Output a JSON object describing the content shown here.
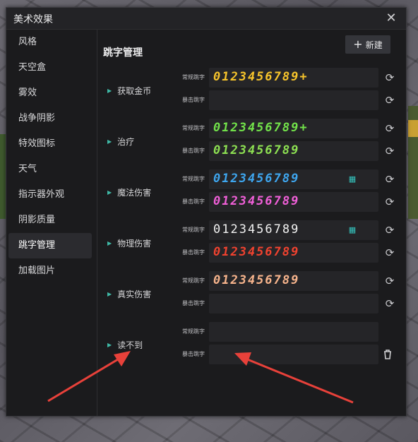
{
  "window": {
    "title": "美术效果",
    "close_glyph": "✕"
  },
  "sidebar": {
    "items": [
      {
        "label": "风格"
      },
      {
        "label": "天空盒"
      },
      {
        "label": "雾效"
      },
      {
        "label": "战争阴影"
      },
      {
        "label": "特效图标"
      },
      {
        "label": "天气"
      },
      {
        "label": "指示器外观"
      },
      {
        "label": "阴影质量"
      },
      {
        "label": "跳字管理"
      },
      {
        "label": "加载图片"
      }
    ],
    "active": "跳字管理"
  },
  "main": {
    "title": "跳字管理",
    "new_button": {
      "icon": "+",
      "label": "新建"
    },
    "row_labels": {
      "normal": "常规跳字",
      "crit": "暴击跳字"
    },
    "groups": [
      {
        "name": "获取金币",
        "normal": {
          "text": "0123456789+",
          "color": "#f7c42b"
        },
        "crit": {
          "text": "",
          "color": "#ffffff"
        }
      },
      {
        "name": "治疗",
        "normal": {
          "text": "0123456789+",
          "color": "#72e24a"
        },
        "crit": {
          "text": "0123456789",
          "color": "#8de052"
        }
      },
      {
        "name": "魔法伤害",
        "normal": {
          "text": "0123456789",
          "color": "#3ea6ef"
        },
        "crit": {
          "text": "0123456789",
          "color": "#f05fd8"
        }
      },
      {
        "name": "物理伤害",
        "normal": {
          "text": "0123456789",
          "color": "#f2f2f2"
        },
        "crit": {
          "text": "0123456789",
          "color": "#f0422f"
        }
      },
      {
        "name": "真实伤害",
        "normal": {
          "text": "0123456789",
          "color": "#f7b48c"
        },
        "crit": {
          "text": "",
          "color": "#ffffff"
        }
      },
      {
        "name": "读不到",
        "normal": {
          "text": "",
          "color": "#ffffff"
        },
        "crit": {
          "text": "",
          "color": "#ffffff"
        }
      }
    ],
    "icons": {
      "refresh": "refresh-icon",
      "delete": "trash-icon",
      "extra_glyph": "extra-glyph-icon"
    }
  },
  "annotation": {
    "arrow_color": "#e8413a"
  }
}
